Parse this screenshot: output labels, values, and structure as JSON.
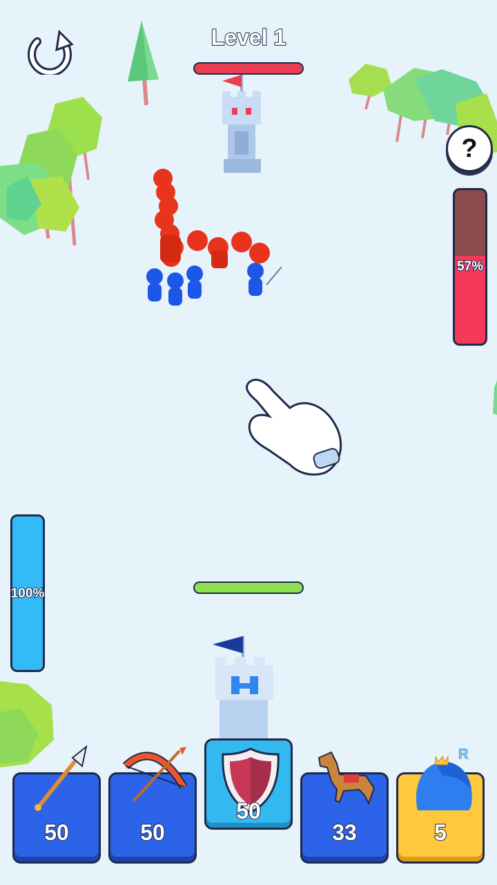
{
  "header": {
    "level_title": "Level 1",
    "restart_icon": "restart-icon",
    "help_label": "?"
  },
  "enemy": {
    "tower_health": 1.0,
    "energy_percent": 57,
    "energy_label": "57%",
    "color": "#ec3e52"
  },
  "player": {
    "tower_health": 1.0,
    "energy_percent": 100,
    "energy_label": "100%",
    "color": "#2d63e8"
  },
  "tutorial": {
    "icon": "pointing-hand-icon"
  },
  "cards": [
    {
      "unit": "spear",
      "icon": "spear-icon",
      "count": "50",
      "selected": false
    },
    {
      "unit": "bow",
      "icon": "bow-icon",
      "count": "50",
      "selected": false
    },
    {
      "unit": "shield",
      "icon": "shield-icon",
      "count": "50",
      "selected": true
    },
    {
      "unit": "horse",
      "icon": "horse-icon",
      "count": "33",
      "selected": false
    },
    {
      "unit": "giant",
      "icon": "giant-icon",
      "count": "5",
      "selected": false,
      "badge": "R"
    }
  ]
}
